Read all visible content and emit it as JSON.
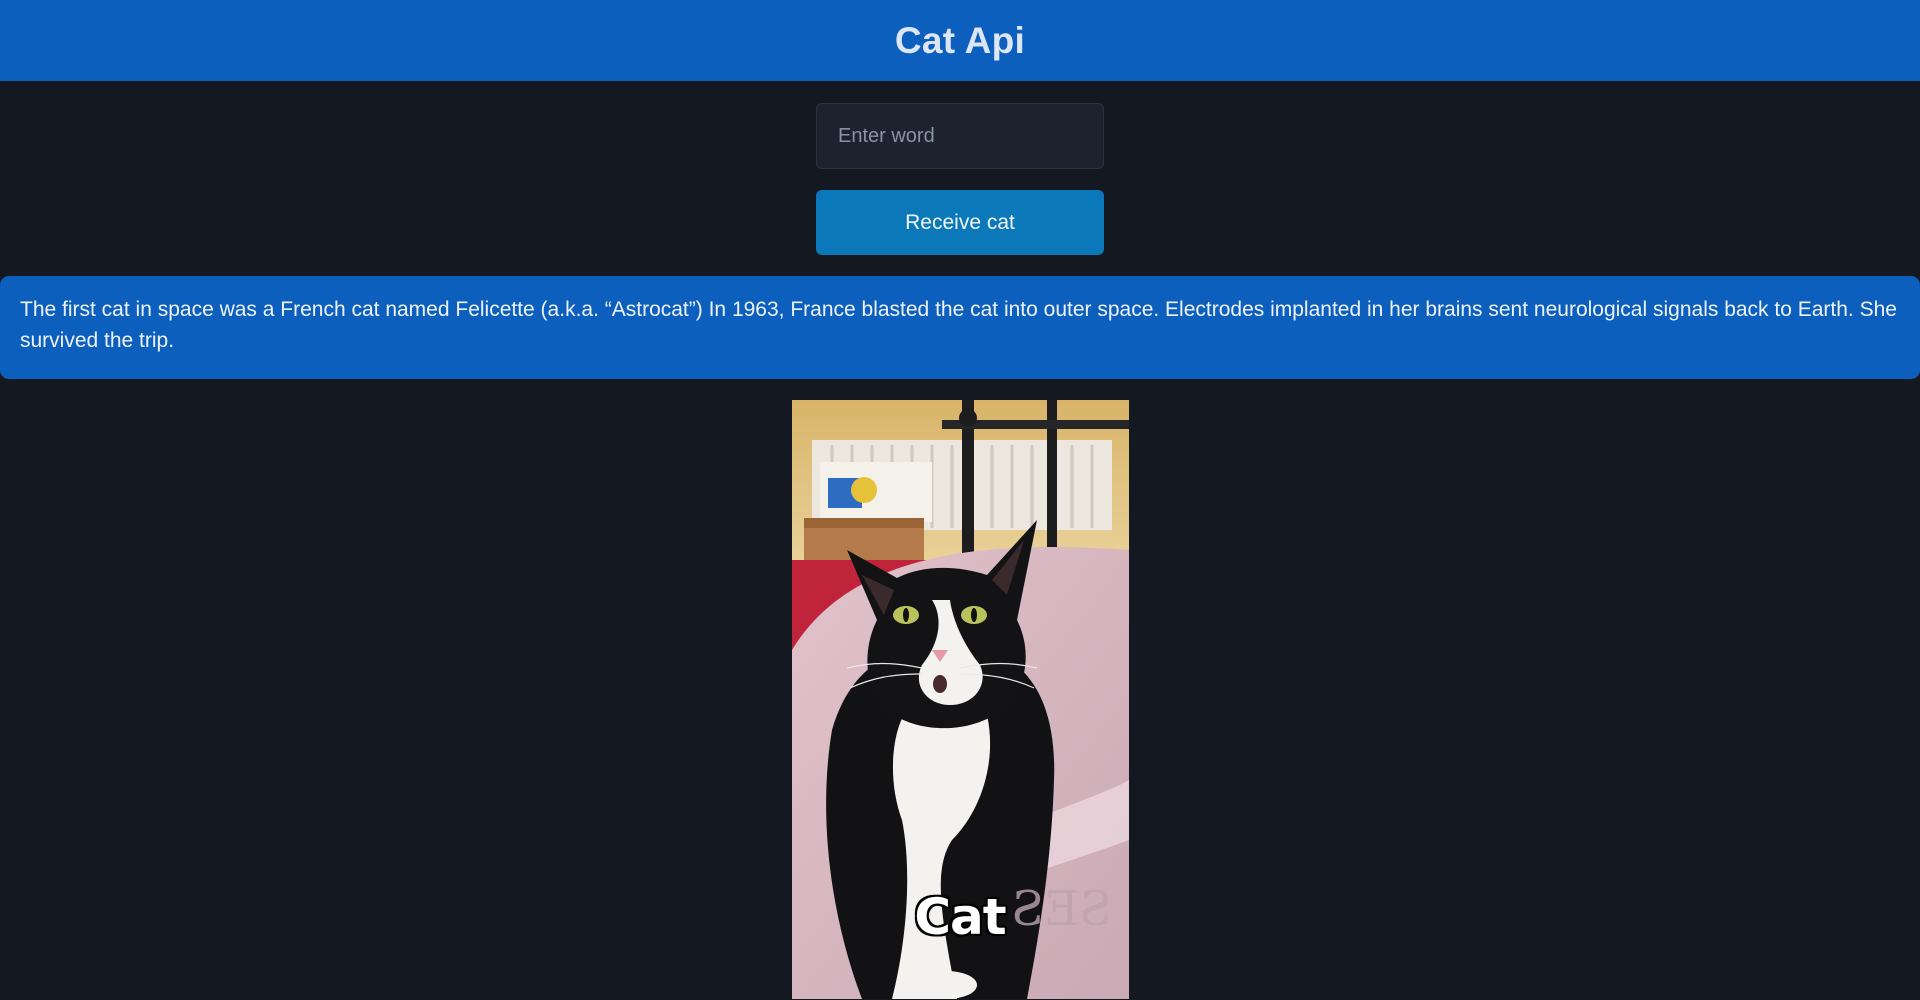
{
  "header": {
    "title": "Cat Api"
  },
  "search": {
    "placeholder": "Enter word",
    "value": ""
  },
  "actions": {
    "receive_label": "Receive cat"
  },
  "fact": {
    "text": "The first cat in space was a French cat named Felicette (a.k.a. “Astrocat”) In 1963, France blasted the cat into outer space. Electrodes implanted in her brains sent neurological signals back to Earth. She survived the trip."
  },
  "cat_image": {
    "caption": "Cat"
  },
  "colors": {
    "header_bg": "#0c5fbd",
    "page_bg": "#141820",
    "button_bg": "#0b78ba",
    "fact_bg": "#0c5fbd"
  }
}
